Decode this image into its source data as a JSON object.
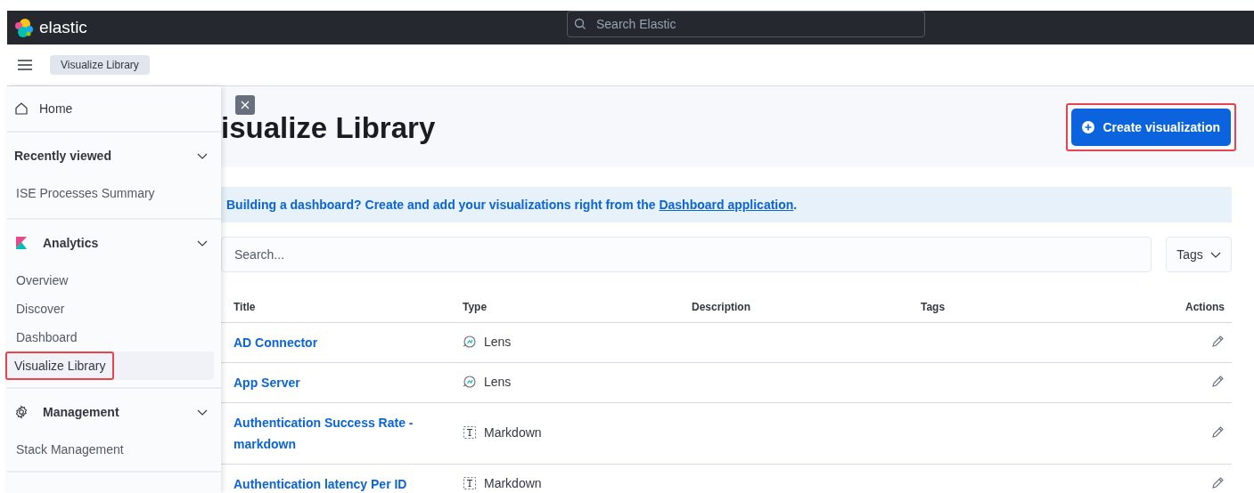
{
  "header": {
    "logo": "elastic",
    "search_placeholder": "Search Elastic"
  },
  "breadcrumb": "Visualize Library",
  "nav": {
    "home": "Home",
    "groups": [
      {
        "kind": "plain",
        "label": "Recently viewed",
        "expanded": true,
        "items": [
          {
            "label": "ISE Processes Summary",
            "selected": false,
            "highlighted": false
          }
        ]
      },
      {
        "kind": "analytics",
        "label": "Analytics",
        "expanded": true,
        "items": [
          {
            "label": "Overview",
            "selected": false,
            "highlighted": false
          },
          {
            "label": "Discover",
            "selected": false,
            "highlighted": false
          },
          {
            "label": "Dashboard",
            "selected": false,
            "highlighted": false
          },
          {
            "label": "Visualize Library",
            "selected": true,
            "highlighted": true
          }
        ]
      },
      {
        "kind": "gear",
        "label": "Management",
        "expanded": true,
        "items": [
          {
            "label": "Stack Management",
            "selected": false,
            "highlighted": false
          }
        ]
      }
    ]
  },
  "page": {
    "title": "isualize Library",
    "create_button": {
      "label": "Create visualization",
      "highlighted": true
    },
    "callout": {
      "text": "Building a dashboard? Create and add your visualizations right from the ",
      "link": "Dashboard application",
      "end": "."
    },
    "search": {
      "placeholder": "Search..."
    },
    "tags_filter": "Tags",
    "table": {
      "columns": [
        "Title",
        "Type",
        "Description",
        "Tags",
        "Actions"
      ],
      "rows": [
        {
          "title": "AD Connector",
          "type": {
            "kind": "lens",
            "label": "Lens"
          }
        },
        {
          "title": "App Server",
          "type": {
            "kind": "lens",
            "label": "Lens"
          }
        },
        {
          "title": "Authentication Success Rate -markdown",
          "type": {
            "kind": "markdown",
            "label": "Markdown"
          }
        },
        {
          "title": "Authentication latency Per ID",
          "type": {
            "kind": "markdown",
            "label": "Markdown"
          }
        }
      ]
    }
  }
}
